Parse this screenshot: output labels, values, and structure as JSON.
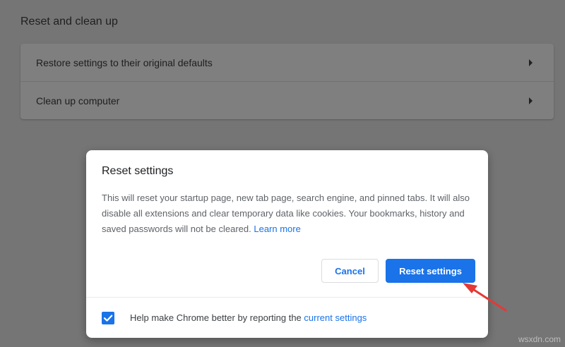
{
  "settings": {
    "section_title": "Reset and clean up",
    "rows": [
      {
        "label": "Restore settings to their original defaults"
      },
      {
        "label": "Clean up computer"
      }
    ]
  },
  "dialog": {
    "title": "Reset settings",
    "body_text": "This will reset your startup page, new tab page, search engine, and pinned tabs. It will also disable all extensions and clear temporary data like cookies. Your bookmarks, history and saved passwords will not be cleared.",
    "learn_more": "Learn more",
    "cancel_label": "Cancel",
    "reset_label": "Reset settings",
    "checkbox_checked": true,
    "footer_text": "Help make Chrome better by reporting the",
    "footer_link": "current settings"
  },
  "colors": {
    "accent": "#1a73e8",
    "annotation_arrow": "#e53935"
  },
  "watermark": "wsxdn.com"
}
